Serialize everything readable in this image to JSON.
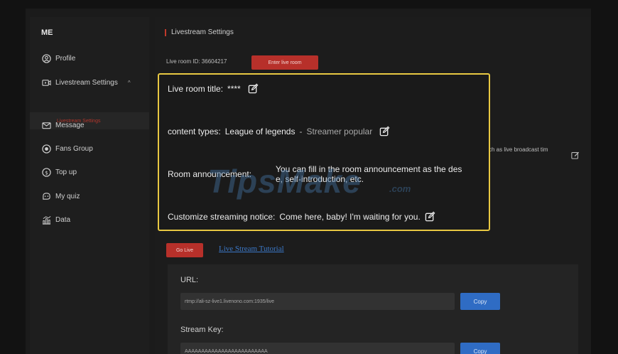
{
  "sidebar": {
    "title": "ME",
    "items": [
      {
        "label": "Profile",
        "icon": "user-circle-icon"
      },
      {
        "label": "Livestream Settings",
        "icon": "video-icon",
        "chevron": "^"
      },
      {
        "label": "Message",
        "icon": "mail-icon"
      },
      {
        "label": "Fans Group",
        "icon": "fans-icon"
      },
      {
        "label": "Top up",
        "icon": "coin-icon"
      },
      {
        "label": "My quiz",
        "icon": "quiz-icon"
      },
      {
        "label": "Data",
        "icon": "chart-icon"
      }
    ],
    "sub_item": "Livestream Settings"
  },
  "main": {
    "title": "Livestream Settings",
    "live_room_id": "Live room ID: 36604217",
    "enter_button": "Enter live room",
    "background_text": "ch as live broadcast tim",
    "go_live_button": "Go Live",
    "tutorial_link": "Live Stream Tutorial",
    "url_label": "URL:",
    "url_value": "rtmp://ali-sz-live1.livenono.com:1935/live",
    "copy_label": "Copy",
    "stream_key_label": "Stream Key:",
    "stream_key_value": "AAAAAAAAAAAAAAAAAAAAAAAAA"
  },
  "popup": {
    "title_label": "Live room title:",
    "title_value": "****",
    "content_label": "content types:",
    "content_value": "League of legends",
    "content_separator": "-",
    "content_sub": "Streamer popular",
    "announcement_label": "Room announcement:",
    "announcement_line1": "You can fill in the room announcement as the des",
    "announcement_line2": "e, self-introduction, etc.",
    "notice_label": "Customize streaming notice:",
    "notice_value": "Come here, baby! I'm waiting for you."
  },
  "watermark": {
    "main": "TipsMake",
    "suffix": ".com"
  },
  "colors": {
    "accent_red": "#b7302a",
    "highlight_yellow": "#e8c842",
    "link_blue": "#3b78c8",
    "copy_blue": "#2f6cc4"
  }
}
